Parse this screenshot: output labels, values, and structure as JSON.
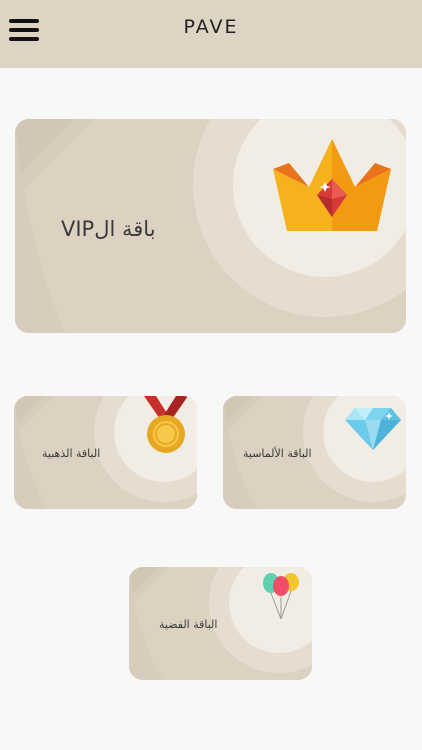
{
  "header": {
    "title": "PAVE",
    "menu_icon": "hamburger-menu-icon"
  },
  "packages": {
    "vip": {
      "label": "باقة الVIP",
      "icon": "crown-icon"
    },
    "gold": {
      "label": "الباقة الذهبية",
      "icon": "gold-medal-icon"
    },
    "diamond": {
      "label": "الباقة الألماسية",
      "icon": "diamond-icon"
    },
    "silver": {
      "label": "الباقة الفضية",
      "icon": "balloons-icon"
    }
  },
  "colors": {
    "header_bg": "#ded4c4",
    "card_bg": "#ddd2c1",
    "page_bg": "#f8f8f8"
  }
}
